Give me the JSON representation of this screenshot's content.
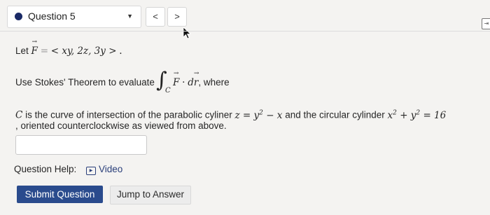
{
  "header": {
    "question_label": "Question 5",
    "prev_label": "<",
    "next_label": ">",
    "side_icon": "exit-icon"
  },
  "problem": {
    "let_prefix": "Let",
    "field_F": "F",
    "equals": "=",
    "field_def": "< xy, 2z, 3y >",
    "period": ".",
    "use_stokes": "Use Stokes' Theorem to evaluate",
    "integrand_F": "F",
    "integrand_dot": "·",
    "integrand_d": "d",
    "integrand_r": "r",
    "integrand_tail": ", where",
    "contour": "C",
    "curve_C": "C",
    "curve_text": "is the curve of intersection of the parabolic cyliner",
    "surface_eq": "z = y",
    "surface_eq_tail": "− x",
    "curve_and": "and the circular cylinder",
    "cyl_x": "x",
    "cyl_plus_y": "+ y",
    "cyl_eq": "= 16",
    "exponent": "2",
    "orientation": ", oriented counterclockwise as viewed from above."
  },
  "answer": {
    "value": ""
  },
  "help": {
    "label": "Question Help:",
    "video_label": "Video"
  },
  "actions": {
    "submit_label": "Submit Question",
    "jump_label": "Jump to Answer"
  },
  "colors": {
    "accent": "#2a4b8d",
    "dot": "#1a2a66"
  }
}
